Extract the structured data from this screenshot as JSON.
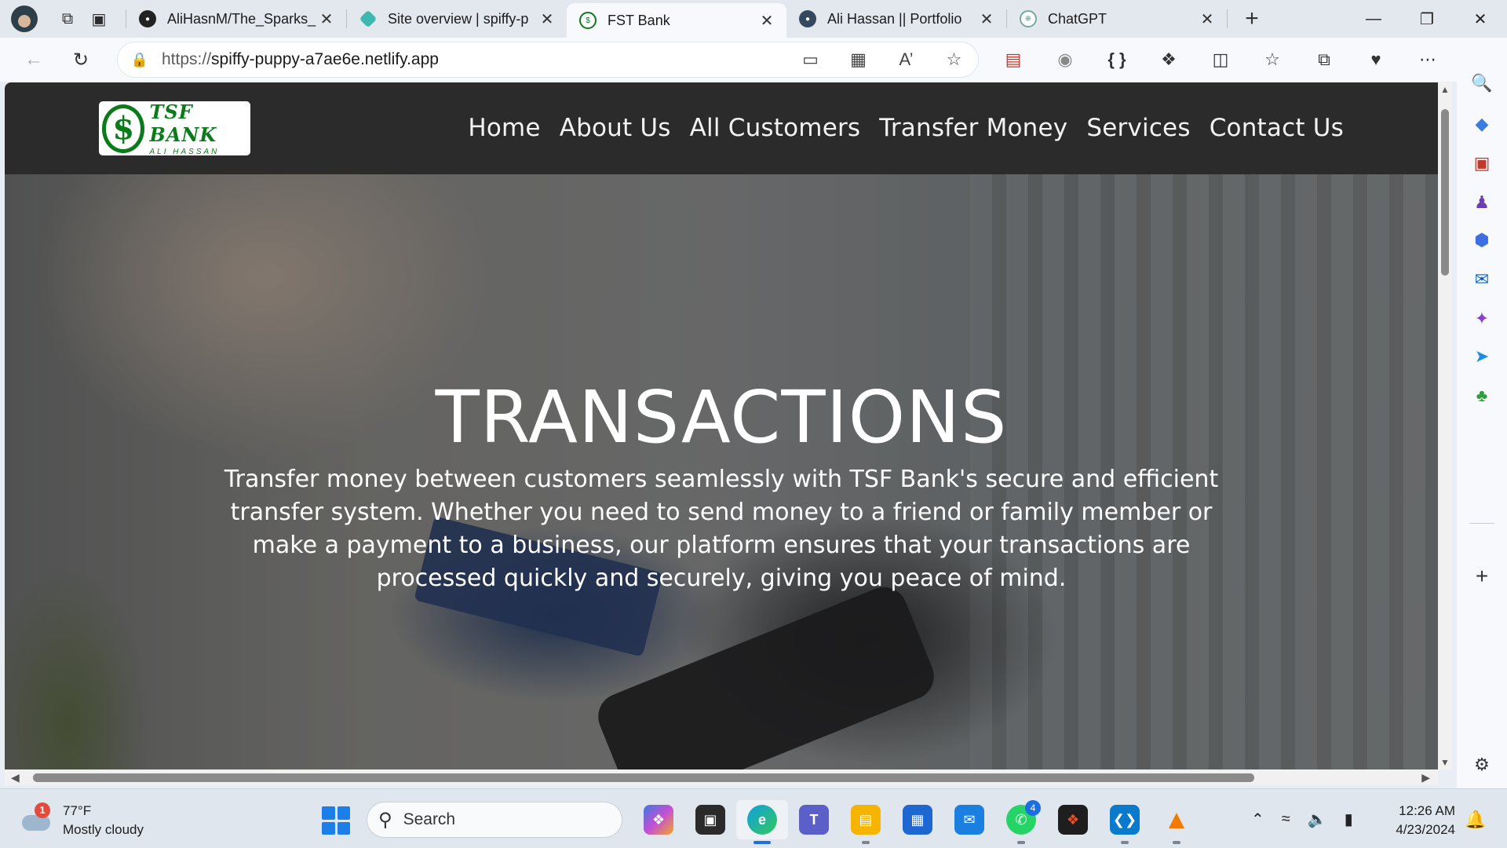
{
  "browser": {
    "tabs": [
      {
        "title": "AliHasnM/The_Sparks_",
        "icon": "github-icon",
        "active": false
      },
      {
        "title": "Site overview | spiffy-p",
        "icon": "netlify-icon",
        "active": false
      },
      {
        "title": "FST Bank",
        "icon": "tsf-bank-favicon",
        "active": true
      },
      {
        "title": "Ali Hassan || Portfolio",
        "icon": "portfolio-favicon",
        "active": false
      },
      {
        "title": "ChatGPT",
        "icon": "chatgpt-icon",
        "active": false
      }
    ],
    "url_scheme": "https://",
    "url_host": "spiffy-puppy-a7ae6e.netlify.app"
  },
  "site": {
    "logo_title": "TSF BANK",
    "logo_subtitle": "ALI HASSAN",
    "nav": [
      "Home",
      "About Us",
      "All Customers",
      "Transfer Money",
      "Services",
      "Contact Us"
    ],
    "hero_title": "TRANSACTIONS",
    "hero_text": "Transfer money between customers seamlessly with TSF Bank's secure and efficient transfer system. Whether you need to send money to a friend or family member or make a payment to a business, our platform ensures that your transactions are processed quickly and securely, giving you peace of mind."
  },
  "taskbar": {
    "weather_temp": "77°F",
    "weather_desc": "Mostly cloudy",
    "weather_badge": "1",
    "search_placeholder": "Search",
    "whatsapp_badge": "4",
    "time": "12:26 AM",
    "date": "4/23/2024"
  },
  "colors": {
    "header_bg": "#2b2b2b",
    "logo_green": "#0b7a1a",
    "accent": "#1c6fe0"
  }
}
